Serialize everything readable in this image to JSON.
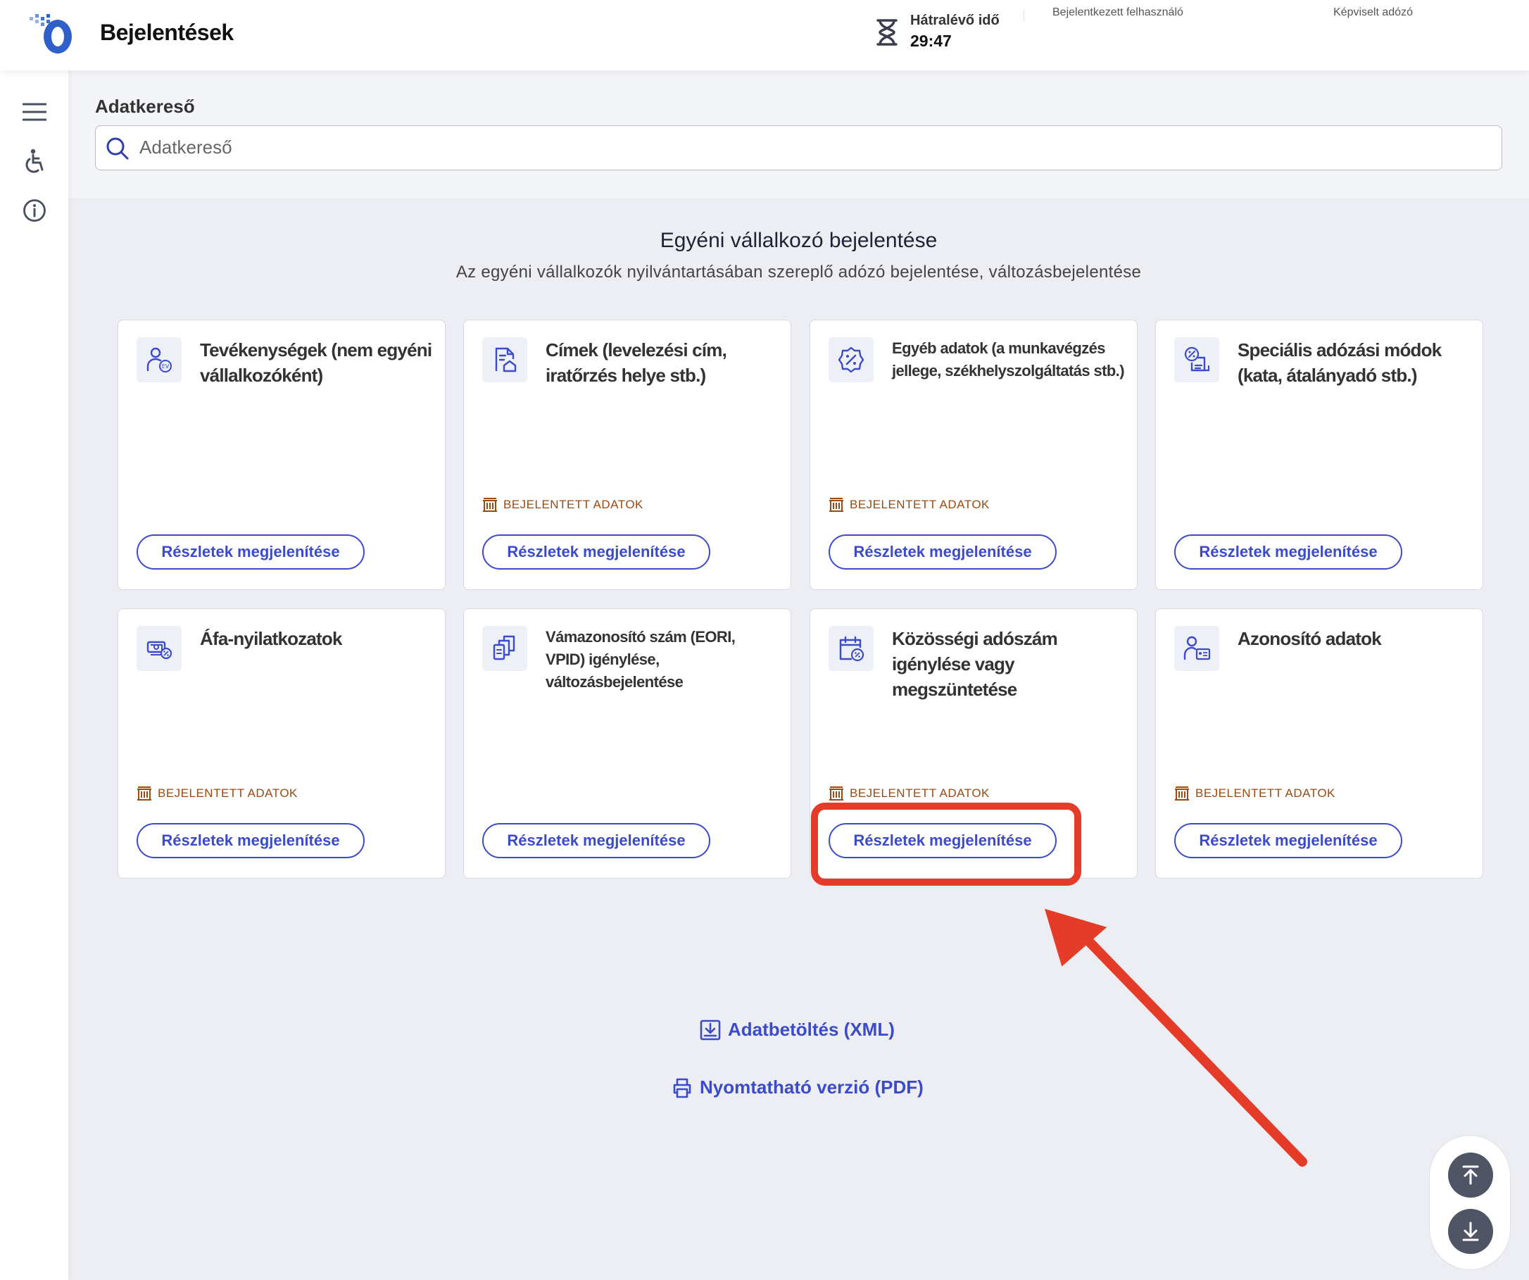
{
  "header": {
    "title": "Bejelentések",
    "timer_label": "Hátralévő idő",
    "timer_value": "29:47",
    "user_label": "Bejelentkezett felhasználó",
    "taxpayer_label": "Képviselt adózó"
  },
  "search": {
    "title": "Adatkereső",
    "placeholder": "Adatkereső"
  },
  "section": {
    "title": "Egyéni vállalkozó bejelentése",
    "subtitle": "Az egyéni vállalkozók nyilvántartásában szereplő adózó bejelentése, változásbejelentése"
  },
  "cards": [
    {
      "title": "Tevékenységek (nem egyéni vállalkozóként)",
      "icon": "person-ev-icon",
      "tag": "",
      "button": "Részletek megjelenítése"
    },
    {
      "title": "Címek (levelezési cím, iratőrzés helye stb.)",
      "icon": "document-home-icon",
      "tag": "BEJELENTETT ADATOK",
      "button": "Részletek megjelenítése"
    },
    {
      "title": "Egyéb adatok (a munkavégzés jellege, székhelyszolgáltatás stb.)",
      "icon": "percent-badge-icon",
      "tag": "BEJELENTETT ADATOK",
      "button": "Részletek megjelenítése"
    },
    {
      "title": "Speciális adózási módok (kata, átalányadó stb.)",
      "icon": "percent-document-icon",
      "tag": "",
      "button": "Részletek megjelenítése"
    },
    {
      "title": "Áfa-nyilatkozatok",
      "icon": "money-percent-icon",
      "tag": "BEJELENTETT ADATOK",
      "button": "Részletek megjelenítése"
    },
    {
      "title": "Vámazonosító szám (EORI, VPID) igénylése, változásbejelentése",
      "icon": "documents-stack-icon",
      "tag": "",
      "button": "Részletek megjelenítése"
    },
    {
      "title": "Közösségi adószám igénylése vagy megszüntetése",
      "icon": "calendar-percent-icon",
      "tag": "BEJELENTETT ADATOK",
      "button": "Részletek megjelenítése"
    },
    {
      "title": "Azonosító adatok",
      "icon": "person-id-icon",
      "tag": "BEJELENTETT ADATOK",
      "button": "Részletek megjelenítése"
    }
  ],
  "links": {
    "xml": "Adatbetöltés (XML)",
    "pdf": "Nyomtatható verzió (PDF)"
  },
  "colors": {
    "accent": "#3b4bc9",
    "tag": "#9a4a12",
    "highlight": "#e43c28"
  }
}
